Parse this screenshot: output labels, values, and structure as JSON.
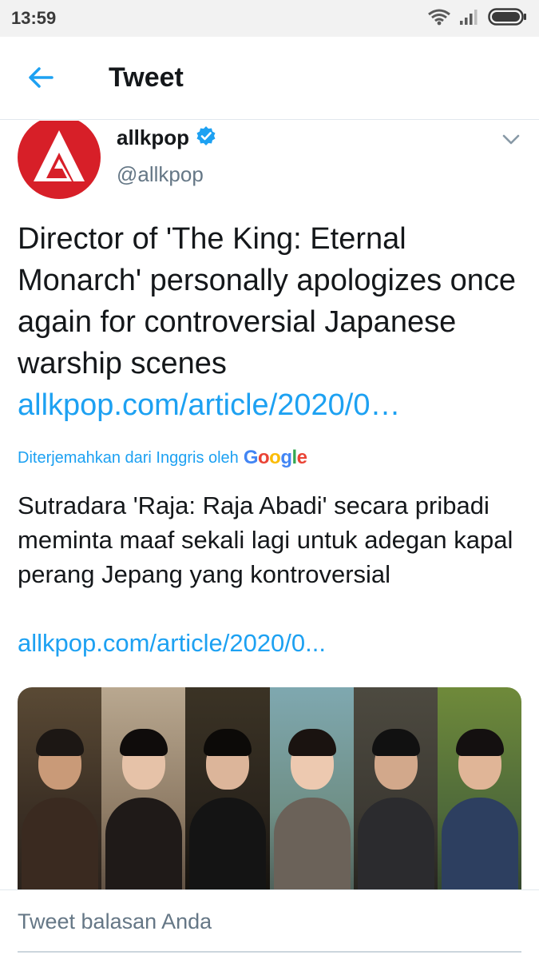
{
  "status_bar": {
    "time": "13:59"
  },
  "header": {
    "title": "Tweet"
  },
  "tweet": {
    "author_name": "allkpop",
    "author_handle": "@allkpop",
    "text": "Director of 'The King: Eternal Monarch' personally apologizes once again for controversial Japanese warship scenes",
    "link": "allkpop.com/article/2020/0…",
    "translation_label": "Diterjemahkan dari Inggris oleh",
    "translation_provider": "Google",
    "translated_text": "Sutradara 'Raja: Raja Abadi' secara pribadi meminta maaf sekali lagi untuk adegan kapal perang Jepang yang kontroversial",
    "translated_link": "allkpop.com/article/2020/0..."
  },
  "reply": {
    "placeholder": "Tweet balasan Anda"
  },
  "colors": {
    "accent": "#1da1f2",
    "avatar_brand": "#d71f28",
    "text_primary": "#14171a",
    "text_secondary": "#657786"
  },
  "icons": {
    "back": "arrow-left-icon",
    "verified": "verified-badge-icon",
    "caret": "chevron-down-icon",
    "wifi": "wifi-icon",
    "signal": "signal-icon",
    "battery": "battery-icon"
  }
}
